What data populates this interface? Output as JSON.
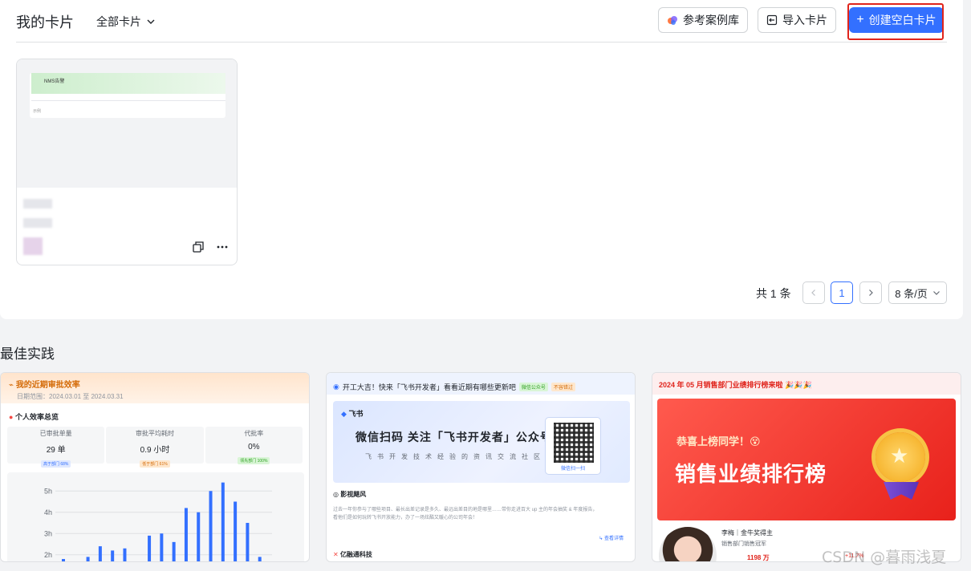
{
  "header": {
    "title": "我的卡片",
    "filter_label": "全部卡片",
    "ref_button": "参考案例库",
    "import_button": "导入卡片",
    "create_button": "创建空白卡片"
  },
  "card": {
    "thumb_label": "NMS告警",
    "thumb_sub": "示例"
  },
  "pagination": {
    "total": "共 1 条",
    "current_page": "1",
    "page_size": "8 条/页"
  },
  "section": {
    "title": "最佳实践"
  },
  "templates": [
    {
      "title": "我的近期审批效率",
      "date": "日期范围：2024.03.01 至 2024.03.31",
      "subtitle": "个人效率总览",
      "stats": [
        {
          "label": "已审批单量",
          "value": "29 单",
          "badge": "高于部门 68%"
        },
        {
          "label": "审批平均耗时",
          "value": "0.9 小时",
          "badge": "低于部门 61%"
        },
        {
          "label": "代批率",
          "value": "0%",
          "badge": "领先部门 100%"
        }
      ]
    },
    {
      "header": "开工大吉！快来「飞书开发者」看看近期有哪些更新吧",
      "tag1": "微信公众号",
      "tag2": "不容错过",
      "logo": "飞书",
      "banner_main": "微信扫码 关注「飞书开发者」公众号",
      "banner_sub": "飞书开发技术经验的资讯交流社区",
      "qr_caption": "微信扫一扫",
      "post_title": "影视飓风",
      "post_text": "过去一年你参与了哪些项目、最长出差记录是多久、最远出差目的地是哪里……带你走进百大 up 主的年会抽奖 & 年度报告，看他们是如何玩转飞书开放能力，办了一场炫酷又暖心的公司年会！",
      "more": "查看详情",
      "company": "亿融通科技"
    },
    {
      "header": "2024 年 05 月销售部门业绩排行榜来啦 🎉🎉🎉",
      "congrats": "恭喜上榜同学！😵",
      "banner_title": "销售业绩排行榜",
      "name": "李梅｜金牛奖得主",
      "desc": "销售部门销售冠军",
      "amount": "1198 万",
      "pct": "+11.7%"
    }
  ],
  "chart_data": {
    "type": "bar",
    "ylabel": "",
    "yticks": [
      "2h",
      "3h",
      "4h",
      "5h"
    ],
    "ylim": [
      1.5,
      5.5
    ],
    "values": [
      1.8,
      1.4,
      1.9,
      2.4,
      2.2,
      2.3,
      1.6,
      2.9,
      3.0,
      2.6,
      4.2,
      4.0,
      5.0,
      5.4,
      4.5,
      3.5,
      1.9
    ]
  },
  "colors": {
    "primary": "#3370ff",
    "highlight_border": "#e0241c"
  },
  "watermark": "CSDN @暮雨浅夏"
}
